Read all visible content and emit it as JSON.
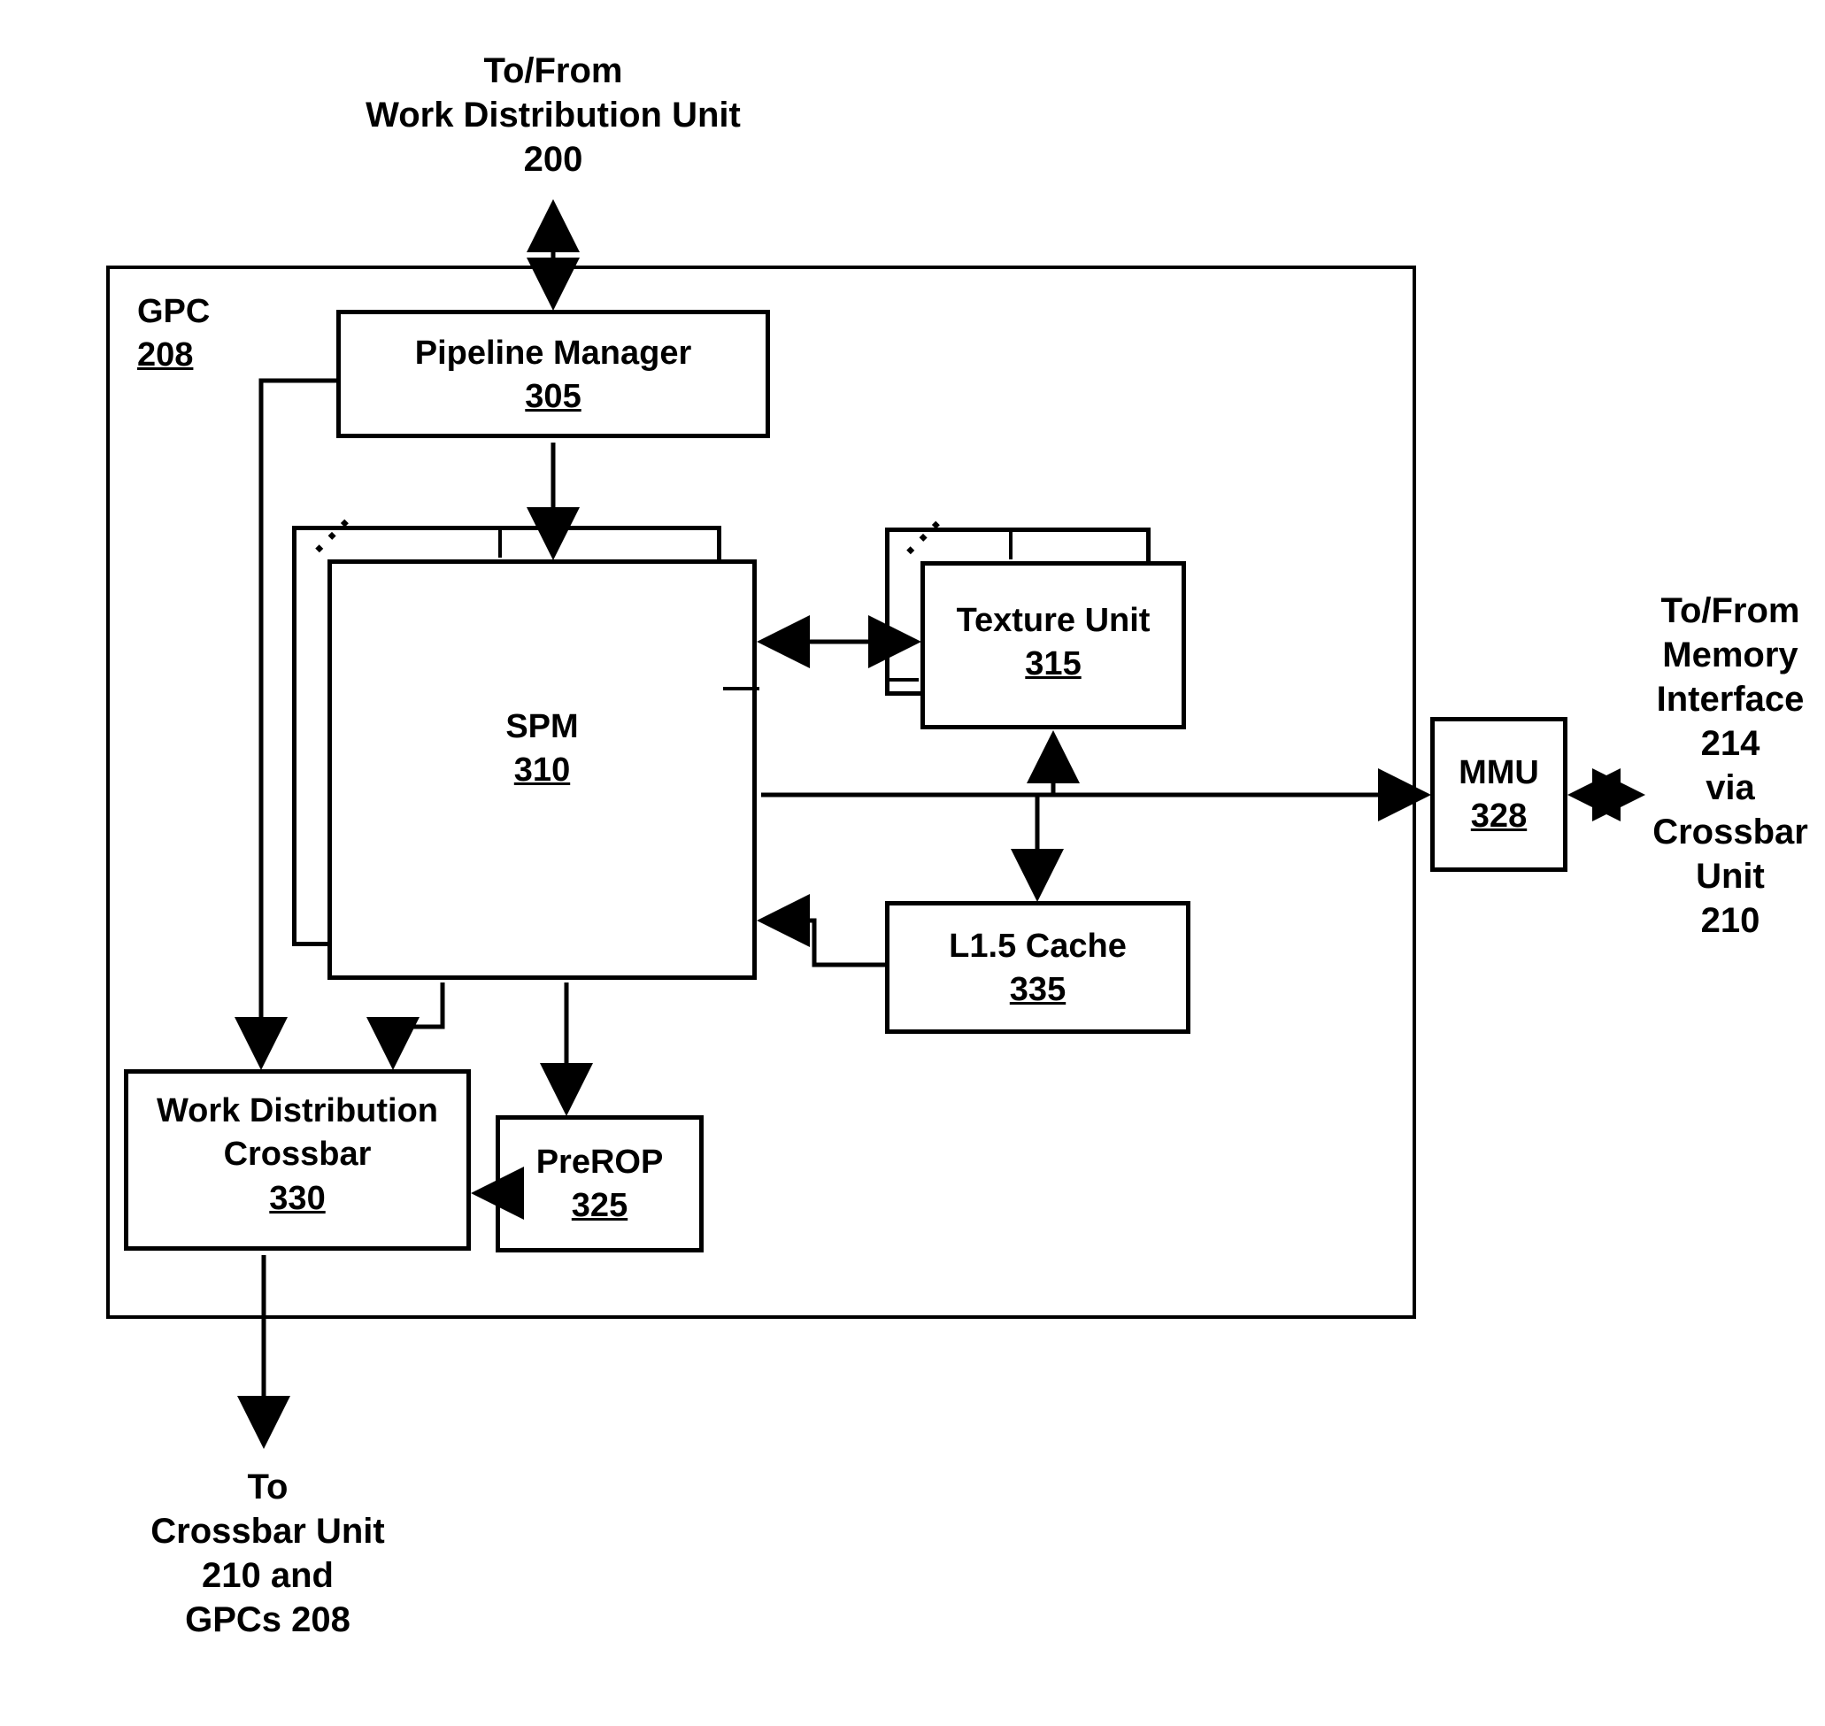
{
  "top_label": {
    "line1": "To/From",
    "line2": "Work Distribution Unit",
    "line3": "200"
  },
  "gpc": {
    "name": "GPC",
    "ref": "208"
  },
  "pipeline_manager": {
    "name": "Pipeline Manager",
    "ref": "305"
  },
  "spm": {
    "name": "SPM",
    "ref": "310"
  },
  "texture_unit": {
    "name": "Texture Unit",
    "ref": "315"
  },
  "l15_cache": {
    "name": "L1.5 Cache",
    "ref": "335"
  },
  "prerop": {
    "name": "PreROP",
    "ref": "325"
  },
  "wdc": {
    "name1": "Work Distribution",
    "name2": "Crossbar",
    "ref": "330"
  },
  "mmu": {
    "name": "MMU",
    "ref": "328"
  },
  "right_label": {
    "l1": "To/From",
    "l2": "Memory",
    "l3": "Interface",
    "l4": "214",
    "l5": "via",
    "l6": "Crossbar",
    "l7": "Unit",
    "l8": "210"
  },
  "bottom_label": {
    "l1": "To",
    "l2": "Crossbar Unit",
    "l3": "210 and",
    "l4": "GPCs 208"
  }
}
